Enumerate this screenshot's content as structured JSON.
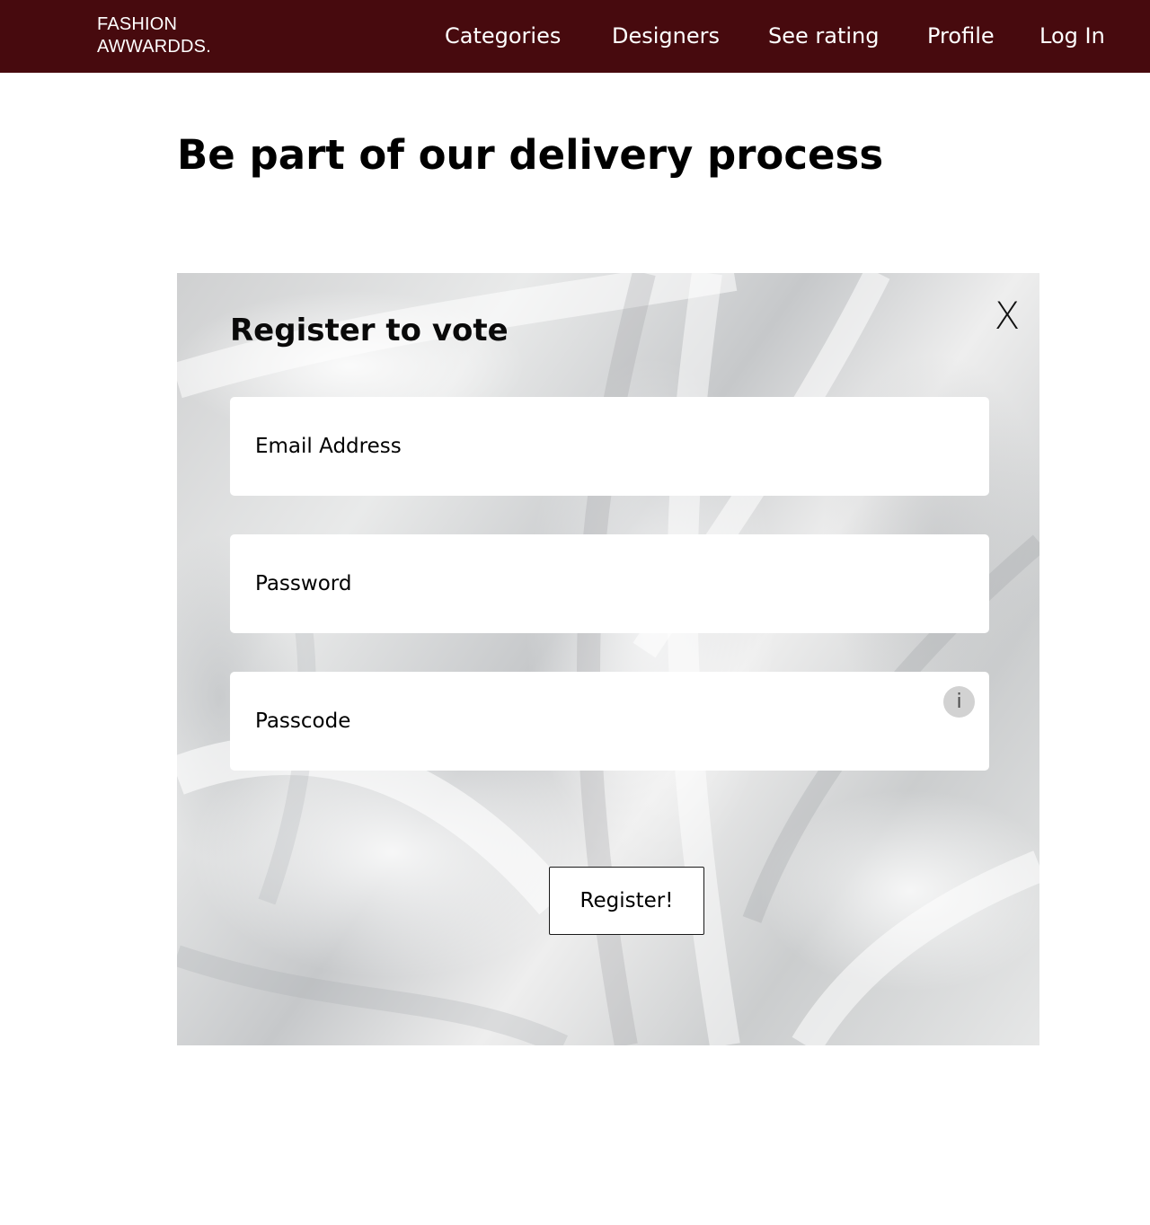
{
  "navbar": {
    "logo_line1": "FASHION",
    "logo_line2": "AWWARDDS.",
    "links": [
      "Categories",
      "Designers",
      "See rating",
      "Profile",
      "Log In"
    ],
    "background_color": "#470a0e"
  },
  "main": {
    "title": "Be part of our delivery process"
  },
  "register_panel": {
    "title": "Register to vote",
    "close_label": "X",
    "email_placeholder": "Email Address",
    "password_placeholder": "Password",
    "passcode_placeholder": "Passcode",
    "info_icon_glyph": "i",
    "info_icon": "info-icon",
    "submit_label": "Register!"
  }
}
